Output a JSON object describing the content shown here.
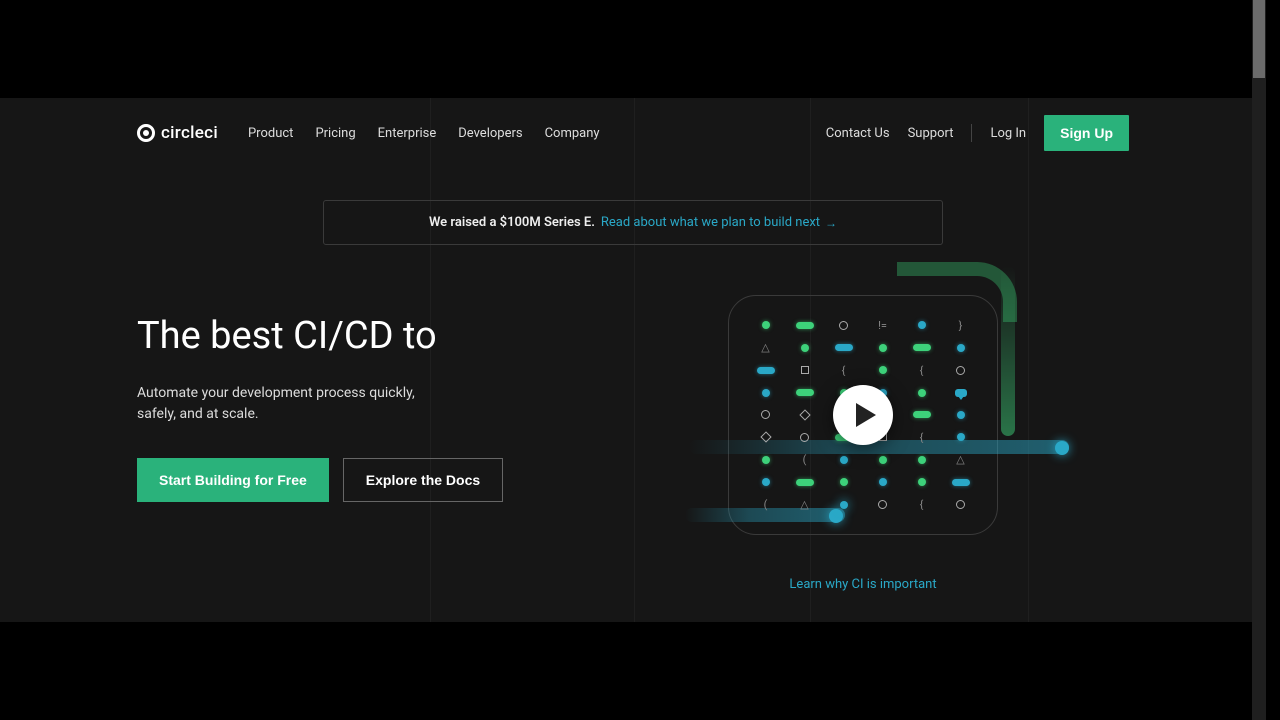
{
  "brand": {
    "name": "circleci"
  },
  "nav": {
    "main": [
      "Product",
      "Pricing",
      "Enterprise",
      "Developers",
      "Company"
    ],
    "right": [
      "Contact Us",
      "Support",
      "Log In"
    ],
    "signup": "Sign Up"
  },
  "banner": {
    "label": "We raised a $100M Series E.",
    "link_text": "Read about what we plan to build next"
  },
  "hero": {
    "title": "The best CI/CD to",
    "subtitle": "Automate your development process quickly, safely, and at scale.",
    "cta_primary": "Start Building for Free",
    "cta_secondary": "Explore the Docs",
    "learn_link": "Learn why CI is important"
  },
  "colors": {
    "accent_green": "#2ab27b",
    "accent_blue": "#2aa8c7",
    "bg_hero": "#161616"
  }
}
